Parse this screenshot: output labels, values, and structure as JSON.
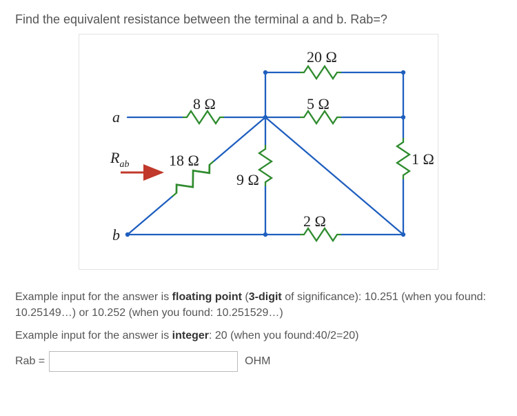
{
  "question": "Find the equivalent resistance between the terminal a and b. Rab=?",
  "circuit": {
    "terminal_a": "a",
    "terminal_b": "b",
    "rab_label": "R",
    "rab_sub": "ab",
    "resistors": {
      "r_top": "20 Ω",
      "r_upper": "8 Ω",
      "r_mid_right": "5 Ω",
      "r_left_diag": "18 Ω",
      "r_center_vert": "9 Ω",
      "r_bottom_right_diag": "2 Ω",
      "r_far_right": "1 Ω"
    }
  },
  "hints": {
    "line1_a": "Example input for the answer is ",
    "line1_b": "floating point",
    "line1_c": " (",
    "line1_d": "3-digit",
    "line1_e": " of significance): 10.251 (when you found: 10.25149…) or 10.252 (when you found: 10.251529…)",
    "line2_a": "Example input for the answer is ",
    "line2_b": "integer",
    "line2_c": ": 20 (when you found:40/2=20)"
  },
  "answer": {
    "label": "Rab =",
    "value": "",
    "unit": "OHM"
  }
}
